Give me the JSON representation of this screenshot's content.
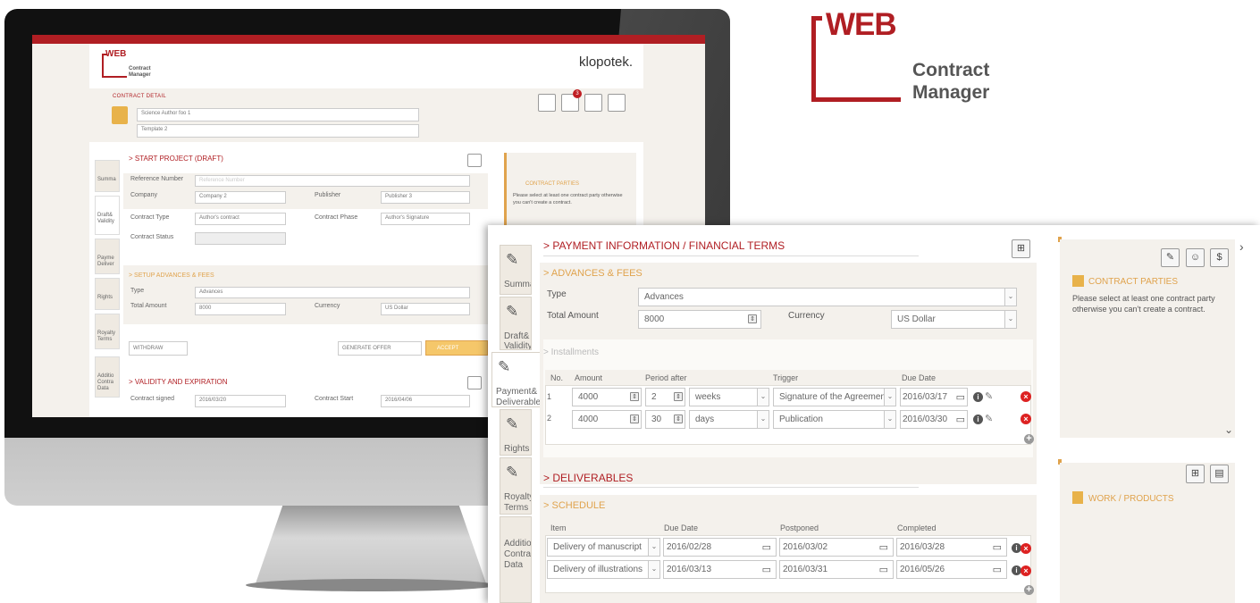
{
  "logo": {
    "brand": "WEB",
    "line1": "Contract",
    "line2": "Manager"
  },
  "monitor": {
    "brand": "klopotek.",
    "logo": {
      "brand": "WEB",
      "line1": "Contract",
      "line2": "Manager"
    },
    "header": {
      "title": "CONTRACT DETAIL",
      "field1": "Science Author foo 1",
      "field2": "Template 2",
      "badge": "3"
    },
    "section_start": "> START PROJECT (DRAFT)",
    "tabs": [
      "Summa",
      "Draft& Validity",
      "Payme Deliver",
      "Rights",
      "Royalty Terms",
      "Additio Contra Data"
    ],
    "form": {
      "reference_label": "Reference Number",
      "reference_placeholder": "Reference Number",
      "company_label": "Company",
      "company_value": "Company 2",
      "publisher_label": "Publisher",
      "publisher_value": "Publisher 3",
      "contract_type_label": "Contract Type",
      "contract_type_value": "Author's contract",
      "contract_phase_label": "Contract Phase",
      "contract_phase_value": "Author's Signature",
      "contract_status_label": "Contract Status"
    },
    "setup": {
      "title": "> SETUP ADVANCES & FEES",
      "type_label": "Type",
      "type_value": "Advances",
      "amount_label": "Total Amount",
      "amount_value": "8000",
      "currency_label": "Currency",
      "currency_value": "US Dollar"
    },
    "buttons": {
      "withdraw": "WITHDRAW",
      "generate_offer": "GENERATE OFFER",
      "accept": "ACCEPT"
    },
    "validity": {
      "title": "> VALIDITY AND EXPIRATION",
      "signed_label": "Contract signed",
      "signed_value": "2016/03/20",
      "start_label": "Contract Start",
      "start_value": "2016/04/06"
    },
    "parties": {
      "title": "CONTRACT PARTIES",
      "text": "Please select at least one contract party otherwise you can't create a contract."
    }
  },
  "panel": {
    "tabs": [
      "Summa",
      "Draft& Validity",
      "Payment& Deliverables",
      "Rights",
      "Royalty Terms",
      "Additio Contra Data"
    ],
    "payment_title": "> PAYMENT INFORMATION / FINANCIAL TERMS",
    "advances_title": "> ADVANCES & FEES",
    "type_label": "Type",
    "type_value": "Advances",
    "amount_label": "Total Amount",
    "amount_value": "8000",
    "currency_label": "Currency",
    "currency_value": "US Dollar",
    "installments_title": "> Installments",
    "inst_headers": [
      "No.",
      "Amount",
      "Period after",
      "Trigger",
      "Due Date"
    ],
    "installments": [
      {
        "no": "1",
        "amount": "4000",
        "period": "2",
        "unit": "weeks",
        "trigger": "Signature of the Agreement",
        "due": "2016/03/17"
      },
      {
        "no": "2",
        "amount": "4000",
        "period": "30",
        "unit": "days",
        "trigger": "Publication",
        "due": "2016/03/30"
      }
    ],
    "deliverables_title": "> DELIVERABLES",
    "schedule_title": "> SCHEDULE",
    "sched_headers": [
      "Item",
      "Due Date",
      "Postponed",
      "Completed"
    ],
    "schedule": [
      {
        "item": "Delivery of manuscript",
        "due": "2016/02/28",
        "postponed": "2016/03/02",
        "completed": "2016/03/28"
      },
      {
        "item": "Delivery of illustrations",
        "due": "2016/03/13",
        "postponed": "2016/03/31",
        "completed": "2016/05/26"
      }
    ],
    "parties_title": "CONTRACT PARTIES",
    "parties_text": "Please select at least one contract party otherwise you can't create a contract.",
    "work_title": "WORK / PRODUCTS"
  },
  "colors": {
    "brand_red": "#b01e23",
    "accent_orange": "#e0a34d",
    "delete_red": "#dd2222"
  }
}
